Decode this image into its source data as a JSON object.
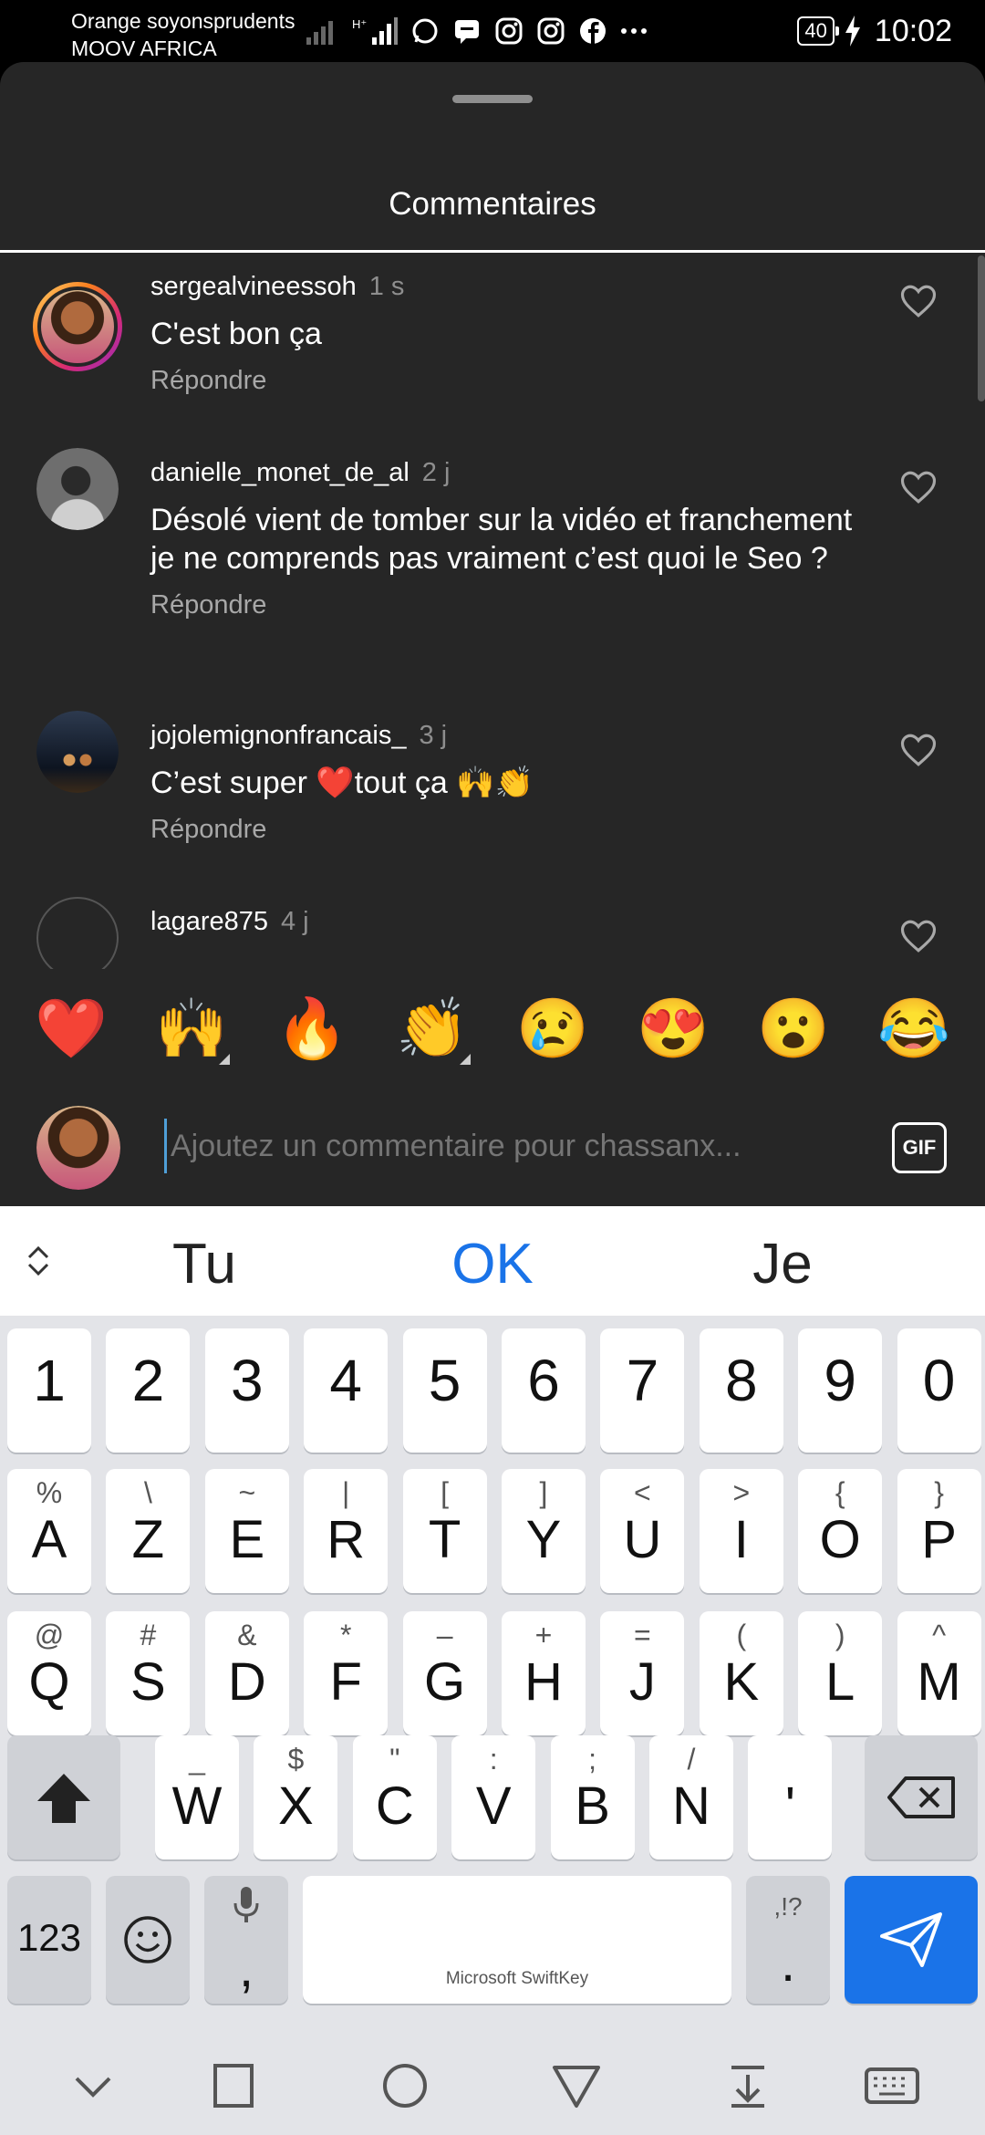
{
  "status_bar": {
    "carrier_line1": "Orange soyonsprudents",
    "carrier_line2": "MOOV AFRICA",
    "battery": "40",
    "time": "10:02"
  },
  "sheet": {
    "title": "Commentaires"
  },
  "comments": [
    {
      "username": "sergealvineessoh",
      "time": "1 s",
      "text": "C'est bon ça",
      "reply": "Répondre"
    },
    {
      "username": "danielle_monet_de_al",
      "time": "2 j",
      "text": "Désolé vient de tomber sur la vidéo et franchement je ne comprends pas vraiment c’est quoi le Seo ?",
      "reply": "Répondre"
    },
    {
      "username": "jojolemignonfrancais_",
      "time": "3 j",
      "text": "C’est super ❤️tout ça 🙌👏",
      "reply": "Répondre"
    },
    {
      "username": "lagare875",
      "time": "4 j",
      "text": "",
      "reply": ""
    }
  ],
  "emoji_bar": [
    "❤️",
    "🙌",
    "🔥",
    "👏",
    "😢",
    "😍",
    "😮",
    "😂"
  ],
  "composer": {
    "placeholder": "Ajoutez un commentaire pour chassanx...",
    "gif_label": "GIF"
  },
  "keyboard": {
    "suggestions": [
      "Tu",
      "OK",
      "Je"
    ],
    "row_numbers": [
      "1",
      "2",
      "3",
      "4",
      "5",
      "6",
      "7",
      "8",
      "9",
      "0"
    ],
    "row1": [
      {
        "k": "A",
        "s": "%"
      },
      {
        "k": "Z",
        "s": "\\"
      },
      {
        "k": "E",
        "s": "~"
      },
      {
        "k": "R",
        "s": "|"
      },
      {
        "k": "T",
        "s": "["
      },
      {
        "k": "Y",
        "s": "]"
      },
      {
        "k": "U",
        "s": "<"
      },
      {
        "k": "I",
        "s": ">"
      },
      {
        "k": "O",
        "s": "{"
      },
      {
        "k": "P",
        "s": "}"
      }
    ],
    "row2": [
      {
        "k": "Q",
        "s": "@"
      },
      {
        "k": "S",
        "s": "#"
      },
      {
        "k": "D",
        "s": "&"
      },
      {
        "k": "F",
        "s": "*"
      },
      {
        "k": "G",
        "s": "–"
      },
      {
        "k": "H",
        "s": "+"
      },
      {
        "k": "J",
        "s": "="
      },
      {
        "k": "K",
        "s": "("
      },
      {
        "k": "L",
        "s": ")"
      },
      {
        "k": "M",
        "s": "^"
      }
    ],
    "row3": [
      {
        "k": "W",
        "s": "_"
      },
      {
        "k": "X",
        "s": "$"
      },
      {
        "k": "C",
        "s": "\""
      },
      {
        "k": "V",
        "s": ":"
      },
      {
        "k": "B",
        "s": ";"
      },
      {
        "k": "N",
        "s": "/"
      },
      {
        "k": "'",
        "s": ""
      }
    ],
    "key_123": "123",
    "key_comma": ",",
    "key_period": ".",
    "key_period_sub": ",!?",
    "space_label": "Microsoft SwiftKey"
  }
}
